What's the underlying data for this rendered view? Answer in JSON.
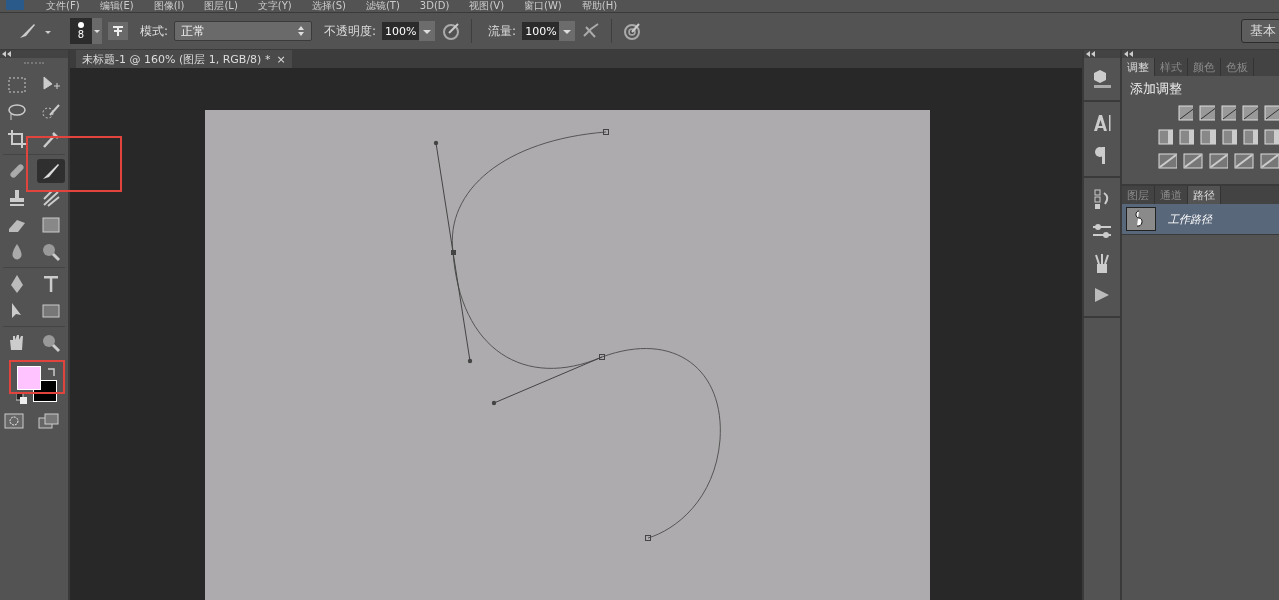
{
  "menu": [
    "文件(F)",
    "编辑(E)",
    "图像(I)",
    "图层(L)",
    "文字(Y)",
    "选择(S)",
    "滤镜(T)",
    "3D(D)",
    "视图(V)",
    "窗口(W)",
    "帮助(H)"
  ],
  "options": {
    "brush_size": "8",
    "mode_label": "模式:",
    "mode_value": "正常",
    "opacity_label": "不透明度:",
    "opacity": "100%",
    "flow_label": "流量:",
    "flow": "100%",
    "workspace_button": "基本"
  },
  "document_tab": {
    "title": "未标题-1 @ 160% (图层 1, RGB/8) *",
    "close": "×"
  },
  "tools": [
    {
      "kind": "marquee",
      "selected": false
    },
    {
      "kind": "move",
      "selected": false
    },
    {
      "kind": "lasso",
      "selected": false
    },
    {
      "kind": "quick-select",
      "selected": false
    },
    {
      "kind": "crop",
      "selected": false
    },
    {
      "kind": "eyedropper",
      "selected": false
    },
    {
      "kind": "healing",
      "selected": false
    },
    {
      "kind": "brush",
      "selected": true
    },
    {
      "kind": "stamp",
      "selected": false
    },
    {
      "kind": "history-brush",
      "selected": false
    },
    {
      "kind": "eraser",
      "selected": false
    },
    {
      "kind": "gradient",
      "selected": false
    },
    {
      "kind": "blur",
      "selected": false
    },
    {
      "kind": "zoom",
      "selected": false
    },
    {
      "kind": "pen",
      "selected": false
    },
    {
      "kind": "type",
      "selected": false
    },
    {
      "kind": "path-select",
      "selected": false
    },
    {
      "kind": "shape",
      "selected": false
    },
    {
      "kind": "hand",
      "selected": false
    },
    {
      "kind": "zoom",
      "selected": false
    }
  ],
  "color_swatches": [
    {
      "kind": "foreground",
      "color": "#ffc4ff"
    },
    {
      "kind": "background",
      "color": "#000000"
    }
  ],
  "adjust_tabs": [
    {
      "label": "调整",
      "selected": true
    },
    {
      "label": "样式",
      "selected": false
    },
    {
      "label": "颜色",
      "selected": false
    },
    {
      "label": "色板",
      "selected": false
    }
  ],
  "adjust_heading": "添加调整",
  "layer_tabs": [
    {
      "label": "图层",
      "selected": false
    },
    {
      "label": "通道",
      "selected": false
    },
    {
      "label": "路径",
      "selected": true
    }
  ],
  "paths": [
    {
      "name": "工作路径",
      "selected": true
    }
  ]
}
